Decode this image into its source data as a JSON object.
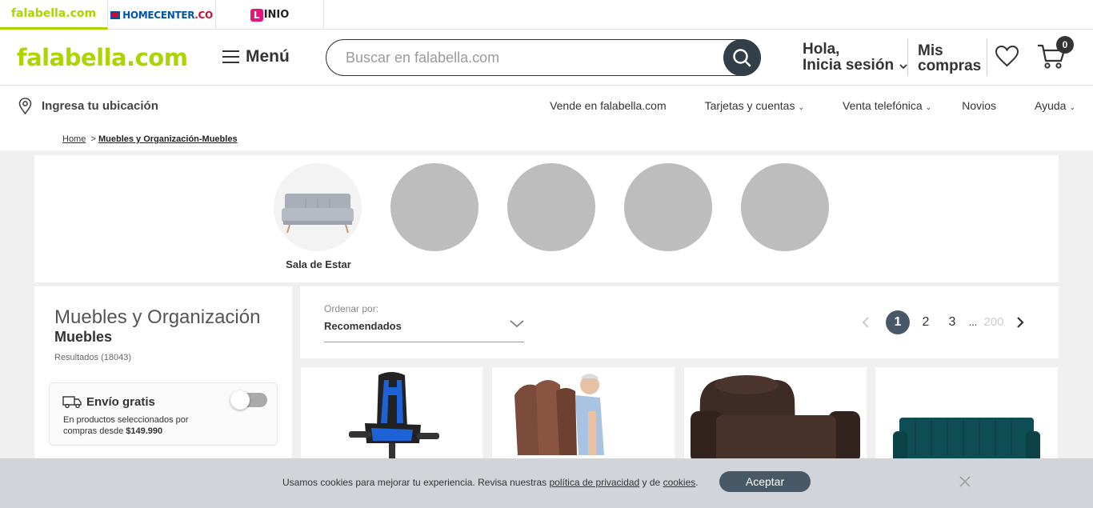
{
  "brand_tabs": [
    {
      "label": "falabella.com"
    },
    {
      "label_main": "HOMECENTER",
      "label_suffix": ".CO"
    },
    {
      "label_main": "INIO",
      "label_prefix": "L"
    }
  ],
  "header": {
    "logo": "falabella.com",
    "menu_label": "Menú",
    "search_placeholder": "Buscar en falabella.com",
    "login_line1": "Hola,",
    "login_line2": "Inicia sesión",
    "purchases_line1": "Mis",
    "purchases_line2": "compras",
    "cart_count": "0"
  },
  "subnav": {
    "location": "Ingresa tu ubicación",
    "links": [
      "Vende en falabella.com",
      "Tarjetas y cuentas",
      "Venta telefónica",
      "Novios",
      "Ayuda"
    ]
  },
  "breadcrumb": {
    "home": "Home",
    "separator": ">",
    "current": "Muebles y Organización-Muebles"
  },
  "categories": [
    {
      "label": "Sala de Estar"
    }
  ],
  "left_panel": {
    "title": "Muebles y Organización",
    "subtitle": "Muebles",
    "results": "Resultados (18043)",
    "free_shipping": {
      "title": "Envío gratis",
      "text1": "En productos seleccionados por",
      "text2_prefix": "compras desde ",
      "text2_amount": "$149.990"
    }
  },
  "sort": {
    "label": "Ordenar por:",
    "value": "Recomendados"
  },
  "pagination": {
    "pages": [
      "1",
      "2",
      "3"
    ],
    "ellipsis": "...",
    "last": "200",
    "current": "1"
  },
  "cookie": {
    "text_before": "Usamos cookies para mejorar tu experiencia. Revisa nuestras ",
    "privacy_link": "política de privacidad",
    "text_middle": " y de ",
    "cookies_link": "cookies",
    "text_after": ".",
    "accept": "Aceptar"
  },
  "colors": {
    "brand_green": "#aad500",
    "dark_button": "#495867",
    "search_button": "#333f48"
  }
}
